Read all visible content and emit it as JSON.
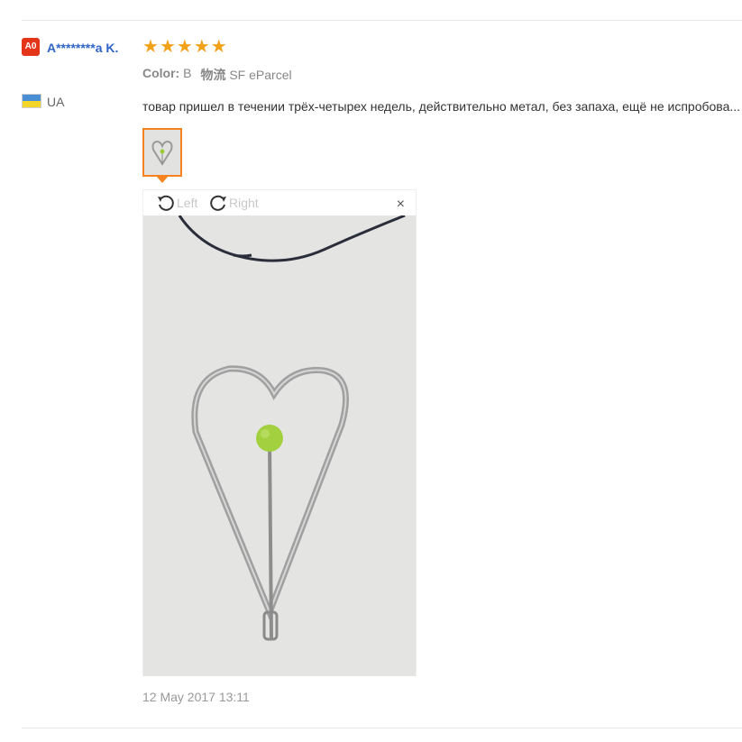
{
  "reviewer": {
    "level_badge": "A0",
    "name": "A********a K.",
    "country_code": "UA",
    "flag_colors": [
      "#4a8ed6",
      "#f4d62b"
    ]
  },
  "review": {
    "rating": 5,
    "stars": [
      "★",
      "★",
      "★",
      "★",
      "★"
    ],
    "attribute_label": "Color:",
    "attribute_value": "B",
    "shipping_label": "物流",
    "shipping_value": "SF eParcel",
    "text": "товар пришел в течении трёх-четырех недель, действительно метал, без запаха, ещё не испробова...",
    "date": "12 May 2017 13:11"
  },
  "viewer": {
    "rotate_left_label": "Left",
    "rotate_right_label": "Right",
    "close_symbol": "×"
  },
  "colors": {
    "accent_orange": "#f7821e",
    "star": "#f2a21a",
    "name_blue": "#2f66c6",
    "badge_red": "#e4351a"
  },
  "icons": [
    "rotate-left-icon",
    "rotate-right-icon",
    "close-icon"
  ]
}
